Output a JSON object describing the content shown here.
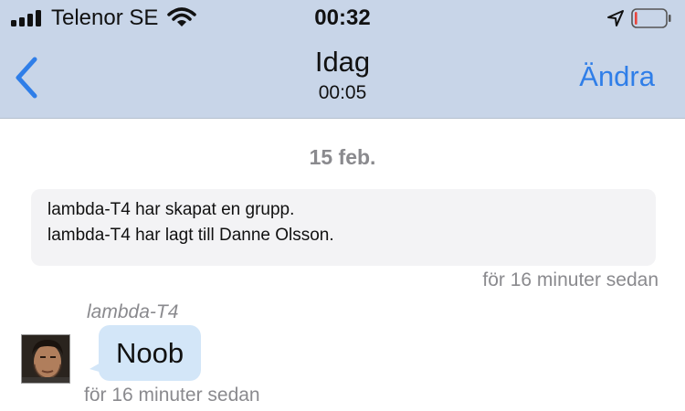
{
  "status_bar": {
    "carrier": "Telenor SE",
    "time": "00:32",
    "battery_level": 0.08,
    "battery_color": "#e8453c"
  },
  "nav": {
    "title": "Idag",
    "subtitle": "00:05",
    "edit_label": "Ändra",
    "back_icon": "chevron-left-icon",
    "accent_color": "#2f7ee8"
  },
  "conversation": {
    "date_separator": "15 feb.",
    "system_messages": [
      "lambda-T4 har skapat en grupp.",
      "lambda-T4 har lagt till Danne Olsson."
    ],
    "system_timestamp": "för 16 minuter sedan",
    "messages": [
      {
        "sender": "lambda-T4",
        "text": "Noob",
        "timestamp": "för 16 minuter sedan",
        "bubble_color": "#d3e6f8"
      }
    ]
  }
}
